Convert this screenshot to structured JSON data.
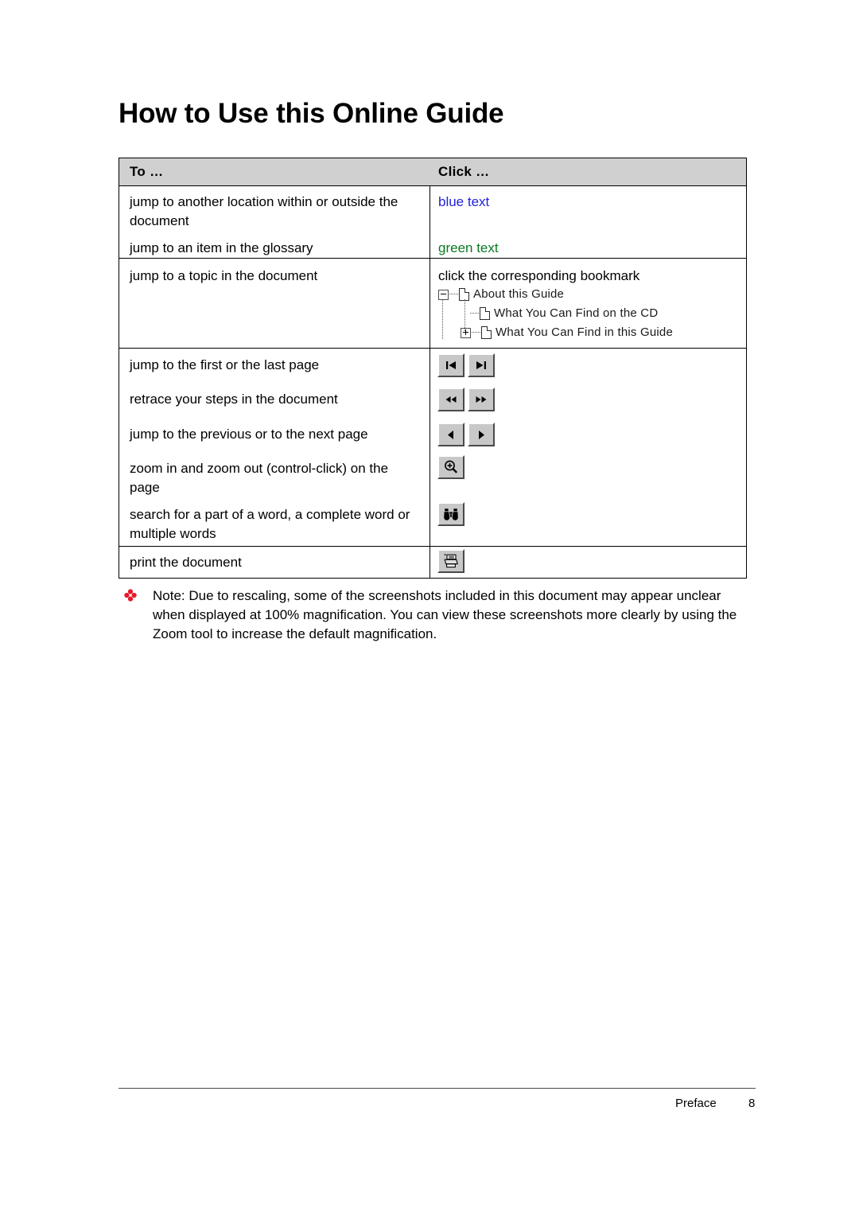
{
  "document": {
    "title": "How to Use this Online Guide"
  },
  "table": {
    "headers": {
      "to": "To …",
      "click": "Click …"
    },
    "rows": [
      {
        "to": "jump to another location within or outside the document",
        "click": "blue text",
        "click_color": "#2222dd"
      },
      {
        "to": "jump to an item in the glossary",
        "click": "green text",
        "click_color": "#0a7a21"
      },
      {
        "to": "jump to a topic in the document",
        "click": "click the corresponding bookmark"
      },
      {
        "to": "jump to the first or the last page",
        "click": ""
      },
      {
        "to": "retrace your steps in the document",
        "click": ""
      },
      {
        "to": "jump to the previous or to the next page",
        "click": ""
      },
      {
        "to": "zoom in and zoom out (control-click) on the page",
        "click": ""
      },
      {
        "to": "search for a part of a word, a complete word or multiple words",
        "click": ""
      },
      {
        "to": "print the document",
        "click": ""
      }
    ],
    "bookmark_tree": [
      {
        "label": "About this Guide",
        "expander": "minus",
        "level": 0
      },
      {
        "label": "What You Can Find on the CD",
        "expander": "none",
        "level": 1
      },
      {
        "label": "What You Can Find in this Guide",
        "expander": "plus",
        "level": 1
      }
    ],
    "buttons": {
      "first_page": "first-page-icon",
      "last_page": "last-page-icon",
      "go_back": "go-back-icon",
      "go_forward": "go-forward-icon",
      "previous_page": "previous-page-icon",
      "next_page": "next-page-icon",
      "zoom": "zoom-in-magnifier-icon",
      "search": "binoculars-search-icon",
      "print": "printer-icon"
    }
  },
  "note": {
    "bullet": "red-clover-bullet-icon",
    "bullet_color": "#e8192c",
    "text": "Note: Due to rescaling, some of the screenshots included in this document may appear unclear when displayed at 100% magnification. You can view these screenshots more clearly by using the Zoom tool to increase the default magnification."
  },
  "footer": {
    "section": "Preface",
    "page_number": "8"
  }
}
